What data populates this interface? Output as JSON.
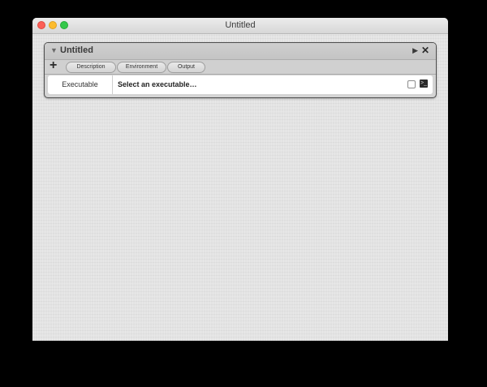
{
  "window": {
    "title": "Untitled"
  },
  "panel": {
    "title": "Untitled",
    "tabs": [
      {
        "label": "Description"
      },
      {
        "label": "Environment"
      },
      {
        "label": "Output"
      }
    ],
    "executable": {
      "label": "Executable",
      "placeholder": "Select an executable…",
      "checkbox_checked": false
    }
  },
  "icons": {
    "disclosure": "disclosure-triangle-icon",
    "run": "play-icon",
    "close": "close-icon",
    "add": "plus-icon",
    "terminal": "terminal-icon"
  }
}
